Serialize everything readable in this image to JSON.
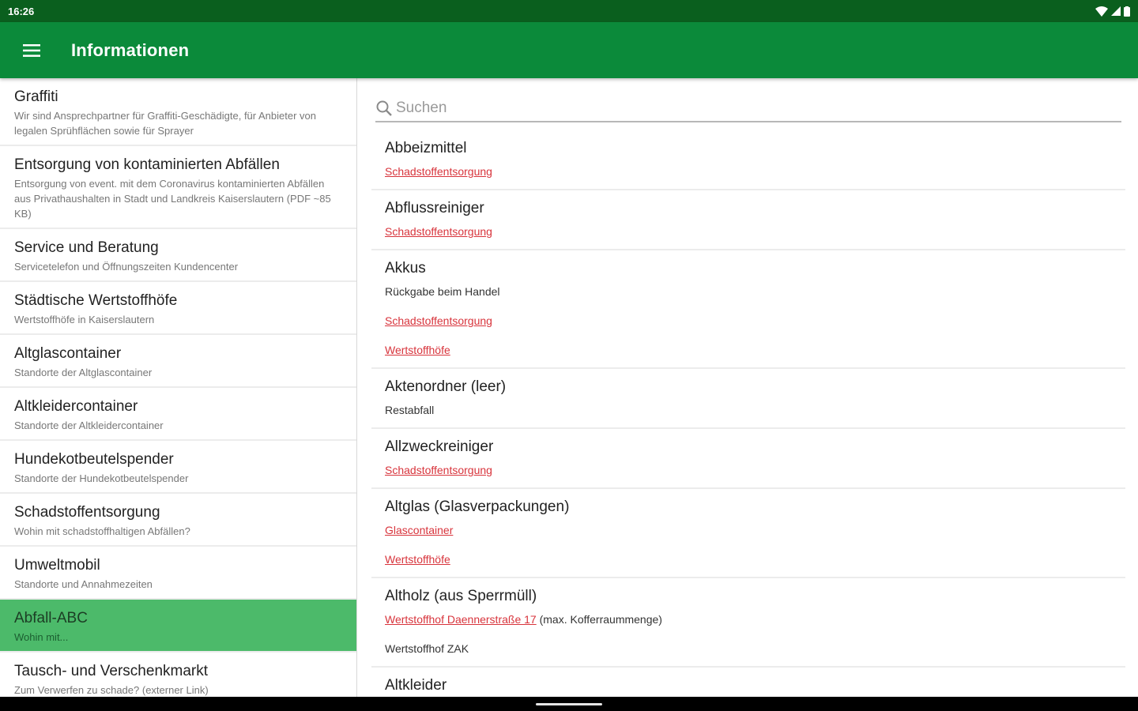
{
  "status": {
    "time": "16:26"
  },
  "app": {
    "title": "Informationen"
  },
  "sidebar": {
    "items": [
      {
        "title": "Graffiti",
        "subtitle": "Wir sind Ansprechpartner für Graffiti-Geschädigte, für Anbieter von legalen Sprühflächen sowie für Sprayer"
      },
      {
        "title": "Entsorgung von kontaminierten Abfällen",
        "subtitle": "Entsorgung von event. mit dem Coronavirus kontaminierten Abfällen aus Privathaushalten in Stadt und Landkreis Kaiserslautern (PDF ~85 KB)"
      },
      {
        "title": "Service und Beratung",
        "subtitle": "Servicetelefon und Öffnungszeiten Kundencenter"
      },
      {
        "title": "Städtische Wertstoffhöfe",
        "subtitle": "Wertstoffhöfe in Kaiserslautern"
      },
      {
        "title": "Altglascontainer",
        "subtitle": "Standorte der Altglascontainer"
      },
      {
        "title": "Altkleidercontainer",
        "subtitle": "Standorte der Altkleidercontainer"
      },
      {
        "title": "Hundekotbeutelspender",
        "subtitle": "Standorte der Hundekotbeutelspender"
      },
      {
        "title": "Schadstoffentsorgung",
        "subtitle": "Wohin mit schadstoffhaltigen Abfällen?"
      },
      {
        "title": "Umweltmobil",
        "subtitle": "Standorte und Annahmezeiten"
      },
      {
        "title": "Abfall-ABC",
        "subtitle": "Wohin mit..."
      },
      {
        "title": "Tausch- und Verschenkmarkt",
        "subtitle": "Zum Verwerfen zu schade? (externer Link)"
      }
    ],
    "active_index": 9
  },
  "search": {
    "placeholder": "Suchen"
  },
  "entries": [
    {
      "title": "Abbeizmittel",
      "link1": "Schadstoffentsorgung"
    },
    {
      "title": "Abflussreiniger",
      "link1": "Schadstoffentsorgung"
    },
    {
      "title": "Akkus",
      "text1": "Rückgabe beim Handel",
      "link1": "Schadstoffentsorgung",
      "link2": "Wertstoffhöfe"
    },
    {
      "title": "Aktenordner (leer)",
      "text1": "Restabfall"
    },
    {
      "title": "Allzweckreiniger",
      "link1": "Schadstoffentsorgung"
    },
    {
      "title": "Altglas (Glasverpackungen)",
      "link1": "Glascontainer",
      "link2": "Wertstoffhöfe"
    },
    {
      "title": "Altholz (aus Sperrmüll)",
      "link1": "Wertstoffhof Daennerstraße 17",
      "text1": " (max. Kofferraummenge)",
      "text2": "Wertstoffhof ZAK"
    },
    {
      "title": "Altkleider"
    }
  ],
  "colors": {
    "status_bar": "#0a5f1e",
    "app_bar": "#0b8a3a",
    "active_item": "#4cba6a",
    "link": "#d8343c"
  }
}
